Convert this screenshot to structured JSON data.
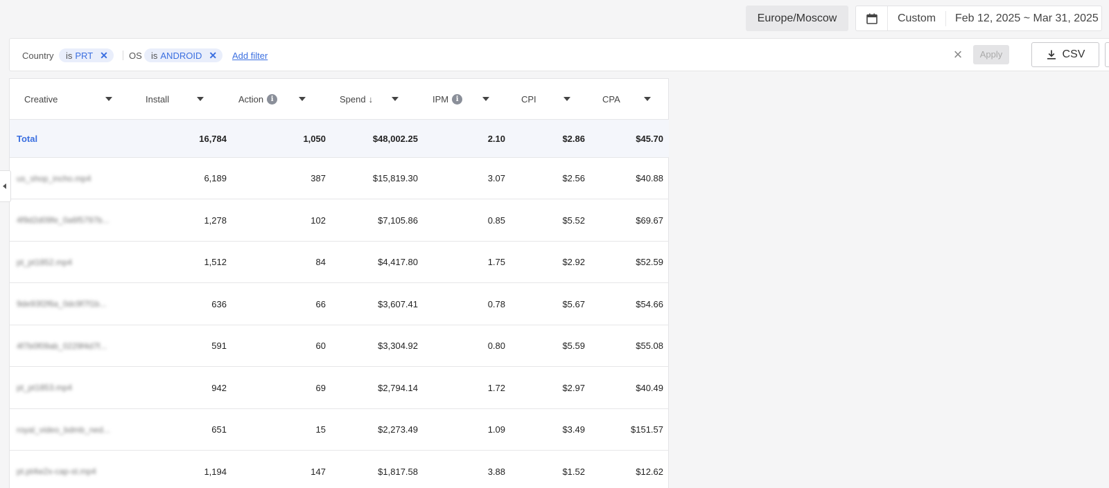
{
  "header": {
    "timezone": "Europe/Moscow",
    "range_mode": "Custom",
    "date_range": "Feb 12, 2025 ~ Mar 31, 2025"
  },
  "filters": {
    "items": [
      {
        "label": "Country",
        "op": "is",
        "value": "PRT"
      },
      {
        "label": "OS",
        "op": "is",
        "value": "ANDROID"
      }
    ],
    "add_filter": "Add filter",
    "apply_label": "Apply",
    "csv_label": "CSV"
  },
  "table": {
    "columns": [
      {
        "label": "Creative"
      },
      {
        "label": "Install"
      },
      {
        "label": "Action",
        "info": "i"
      },
      {
        "label": "Spend",
        "sort": "↓"
      },
      {
        "label": "IPM",
        "info": "i"
      },
      {
        "label": "CPI"
      },
      {
        "label": "CPA"
      }
    ],
    "total": {
      "label": "Total",
      "values": [
        "16,784",
        "1,050",
        "$48,002.25",
        "2.10",
        "$2.86",
        "$45.70"
      ]
    },
    "rows": [
      {
        "creative": "us_shop_incho.mp4",
        "values": [
          "6,189",
          "387",
          "$15,819.30",
          "3.07",
          "$2.56",
          "$40.88"
        ]
      },
      {
        "creative": "4f9d2d09fe_0a6f5797b...",
        "values": [
          "1,278",
          "102",
          "$7,105.86",
          "0.85",
          "$5.52",
          "$69.67"
        ]
      },
      {
        "creative": "pt_pt1852.mp4",
        "values": [
          "1,512",
          "84",
          "$4,417.80",
          "1.75",
          "$2.92",
          "$52.59"
        ]
      },
      {
        "creative": "9de93f2f6a_0dc9f7f1b...",
        "values": [
          "636",
          "66",
          "$3,607.41",
          "0.78",
          "$5.67",
          "$54.66"
        ]
      },
      {
        "creative": "4f7b0f09ab_0229f4d7f...",
        "values": [
          "591",
          "60",
          "$3,304.92",
          "0.80",
          "$5.59",
          "$55.08"
        ]
      },
      {
        "creative": "pt_pt1853.mp4",
        "values": [
          "942",
          "69",
          "$2,794.14",
          "1.72",
          "$2.97",
          "$40.49"
        ]
      },
      {
        "creative": "royal_video_bdmb_ned...",
        "values": [
          "651",
          "15",
          "$2,273.49",
          "1.09",
          "$3.49",
          "$151.57"
        ]
      },
      {
        "creative": "pt.pt4w2x-cap-st.mp4",
        "values": [
          "1,194",
          "147",
          "$1,817.58",
          "3.88",
          "$1.52",
          "$12.62"
        ]
      }
    ]
  }
}
